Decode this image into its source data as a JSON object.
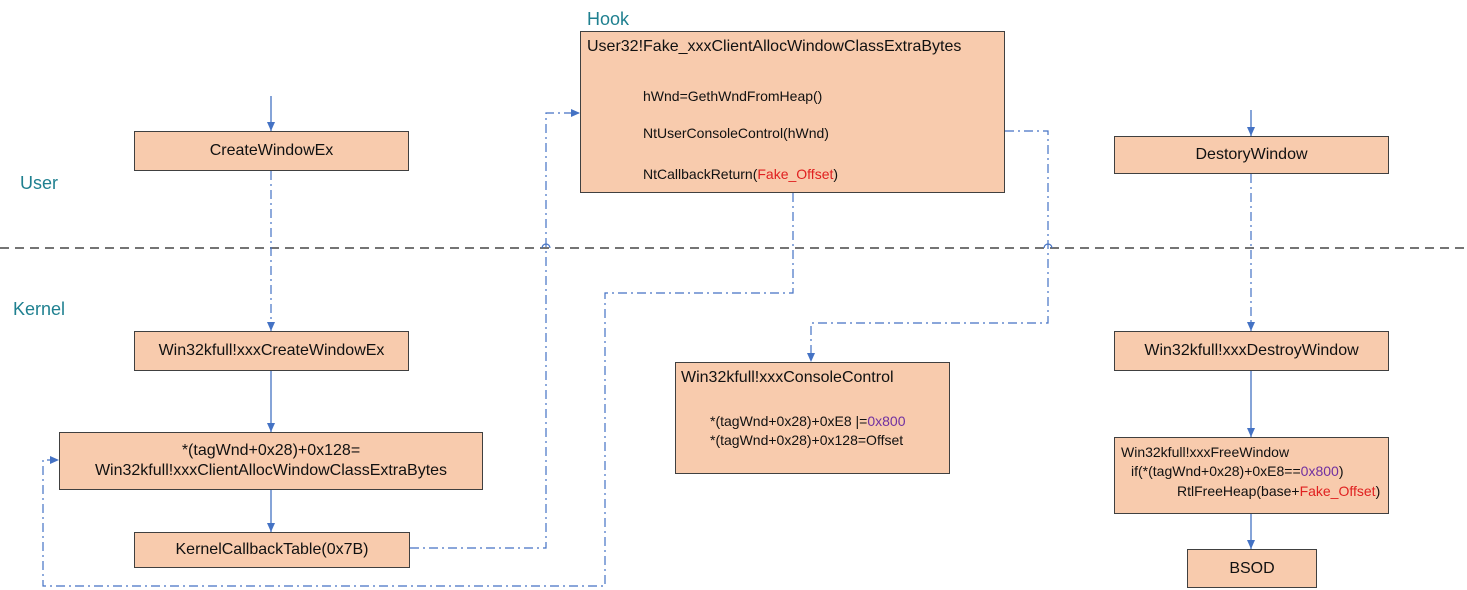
{
  "zones": {
    "user": "User",
    "kernel": "Kernel",
    "hook": "Hook"
  },
  "boxes": {
    "create_window_ex": "CreateWindowEx",
    "xxx_create_window_ex": "Win32kfull!xxxCreateWindowEx",
    "assign": {
      "line1": "*(tagWnd+0x28)+0x128=",
      "line2": "Win32kfull!xxxClientAllocWindowClassExtraBytes"
    },
    "kernel_callback_table": "KernelCallbackTable(0x7B)",
    "fake_callback": {
      "title": "User32!Fake_xxxClientAllocWindowClassExtraBytes",
      "line1": "hWnd=GethWndFromHeap()",
      "line2": "NtUserConsoleControl(hWnd)",
      "line3_prefix": "NtCallbackReturn(",
      "line3_highlight": "Fake_Offset",
      "line3_suffix": ")"
    },
    "console_control": {
      "title": "Win32kfull!xxxConsoleControl",
      "line1_prefix": "*(tagWnd+0x28)+0xE8  |=",
      "line1_highlight": "0x800",
      "line2": "*(tagWnd+0x28)+0x128=Offset"
    },
    "destroy_window": "DestoryWindow",
    "xxx_destroy_window": "Win32kfull!xxxDestroyWindow",
    "free_window": {
      "title": "Win32kfull!xxxFreeWindow",
      "line2_prefix": "if(*(tagWnd+0x28)+0xE8==",
      "line2_highlight": "0x800",
      "line2_suffix": ")",
      "line3_prefix": "RtlFreeHeap(base+",
      "line3_highlight": "Fake_Offset",
      "line3_suffix": ")"
    },
    "bsod": "BSOD"
  },
  "colors": {
    "box_fill": "#f8cbad",
    "connector": "#4472c4",
    "zone_label": "#1f8090",
    "highlight_red": "#e02020",
    "highlight_purple": "#7030a0"
  }
}
